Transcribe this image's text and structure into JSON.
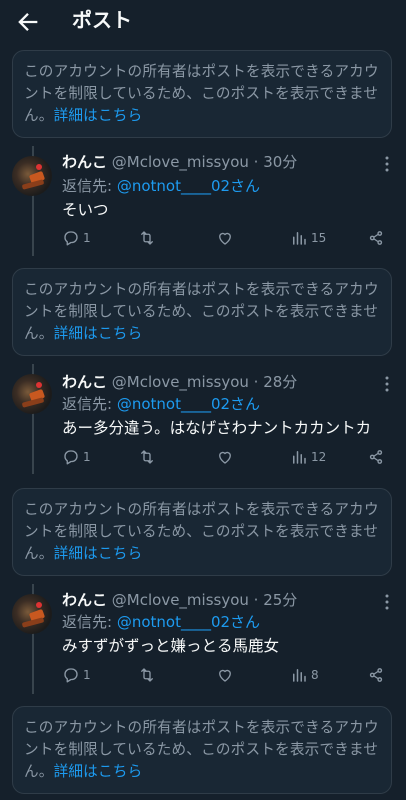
{
  "header": {
    "title": "ポスト"
  },
  "notice": {
    "text": "このアカウントの所有者はポストを表示できるアカウントを制限しているため、このポストを表示できません。",
    "link": "詳細はこちら"
  },
  "posts": [
    {
      "name": "わんこ",
      "handle": "@Mclove_missyou",
      "time": "30分",
      "reply_prefix": "返信先: ",
      "reply_to": "@notnot____02さん",
      "text": "そいつ",
      "replies": "1",
      "retweets": "",
      "likes": "",
      "views": "15"
    },
    {
      "name": "わんこ",
      "handle": "@Mclove_missyou",
      "time": "28分",
      "reply_prefix": "返信先: ",
      "reply_to": "@notnot____02さん",
      "text": "あー多分違う。はなげさわナントカカントカ",
      "replies": "1",
      "retweets": "",
      "likes": "",
      "views": "12"
    },
    {
      "name": "わんこ",
      "handle": "@Mclove_missyou",
      "time": "25分",
      "reply_prefix": "返信先: ",
      "reply_to": "@notnot____02さん",
      "text": "みすずがずっと嫌っとる馬鹿女",
      "replies": "1",
      "retweets": "",
      "likes": "",
      "views": "8"
    }
  ],
  "colors": {
    "background": "#15202b",
    "accent": "#1d9bf0",
    "muted": "#8b98a5"
  },
  "icons": [
    "back-arrow-icon",
    "more-icon",
    "reply-icon",
    "retweet-icon",
    "like-icon",
    "views-icon",
    "share-icon"
  ]
}
